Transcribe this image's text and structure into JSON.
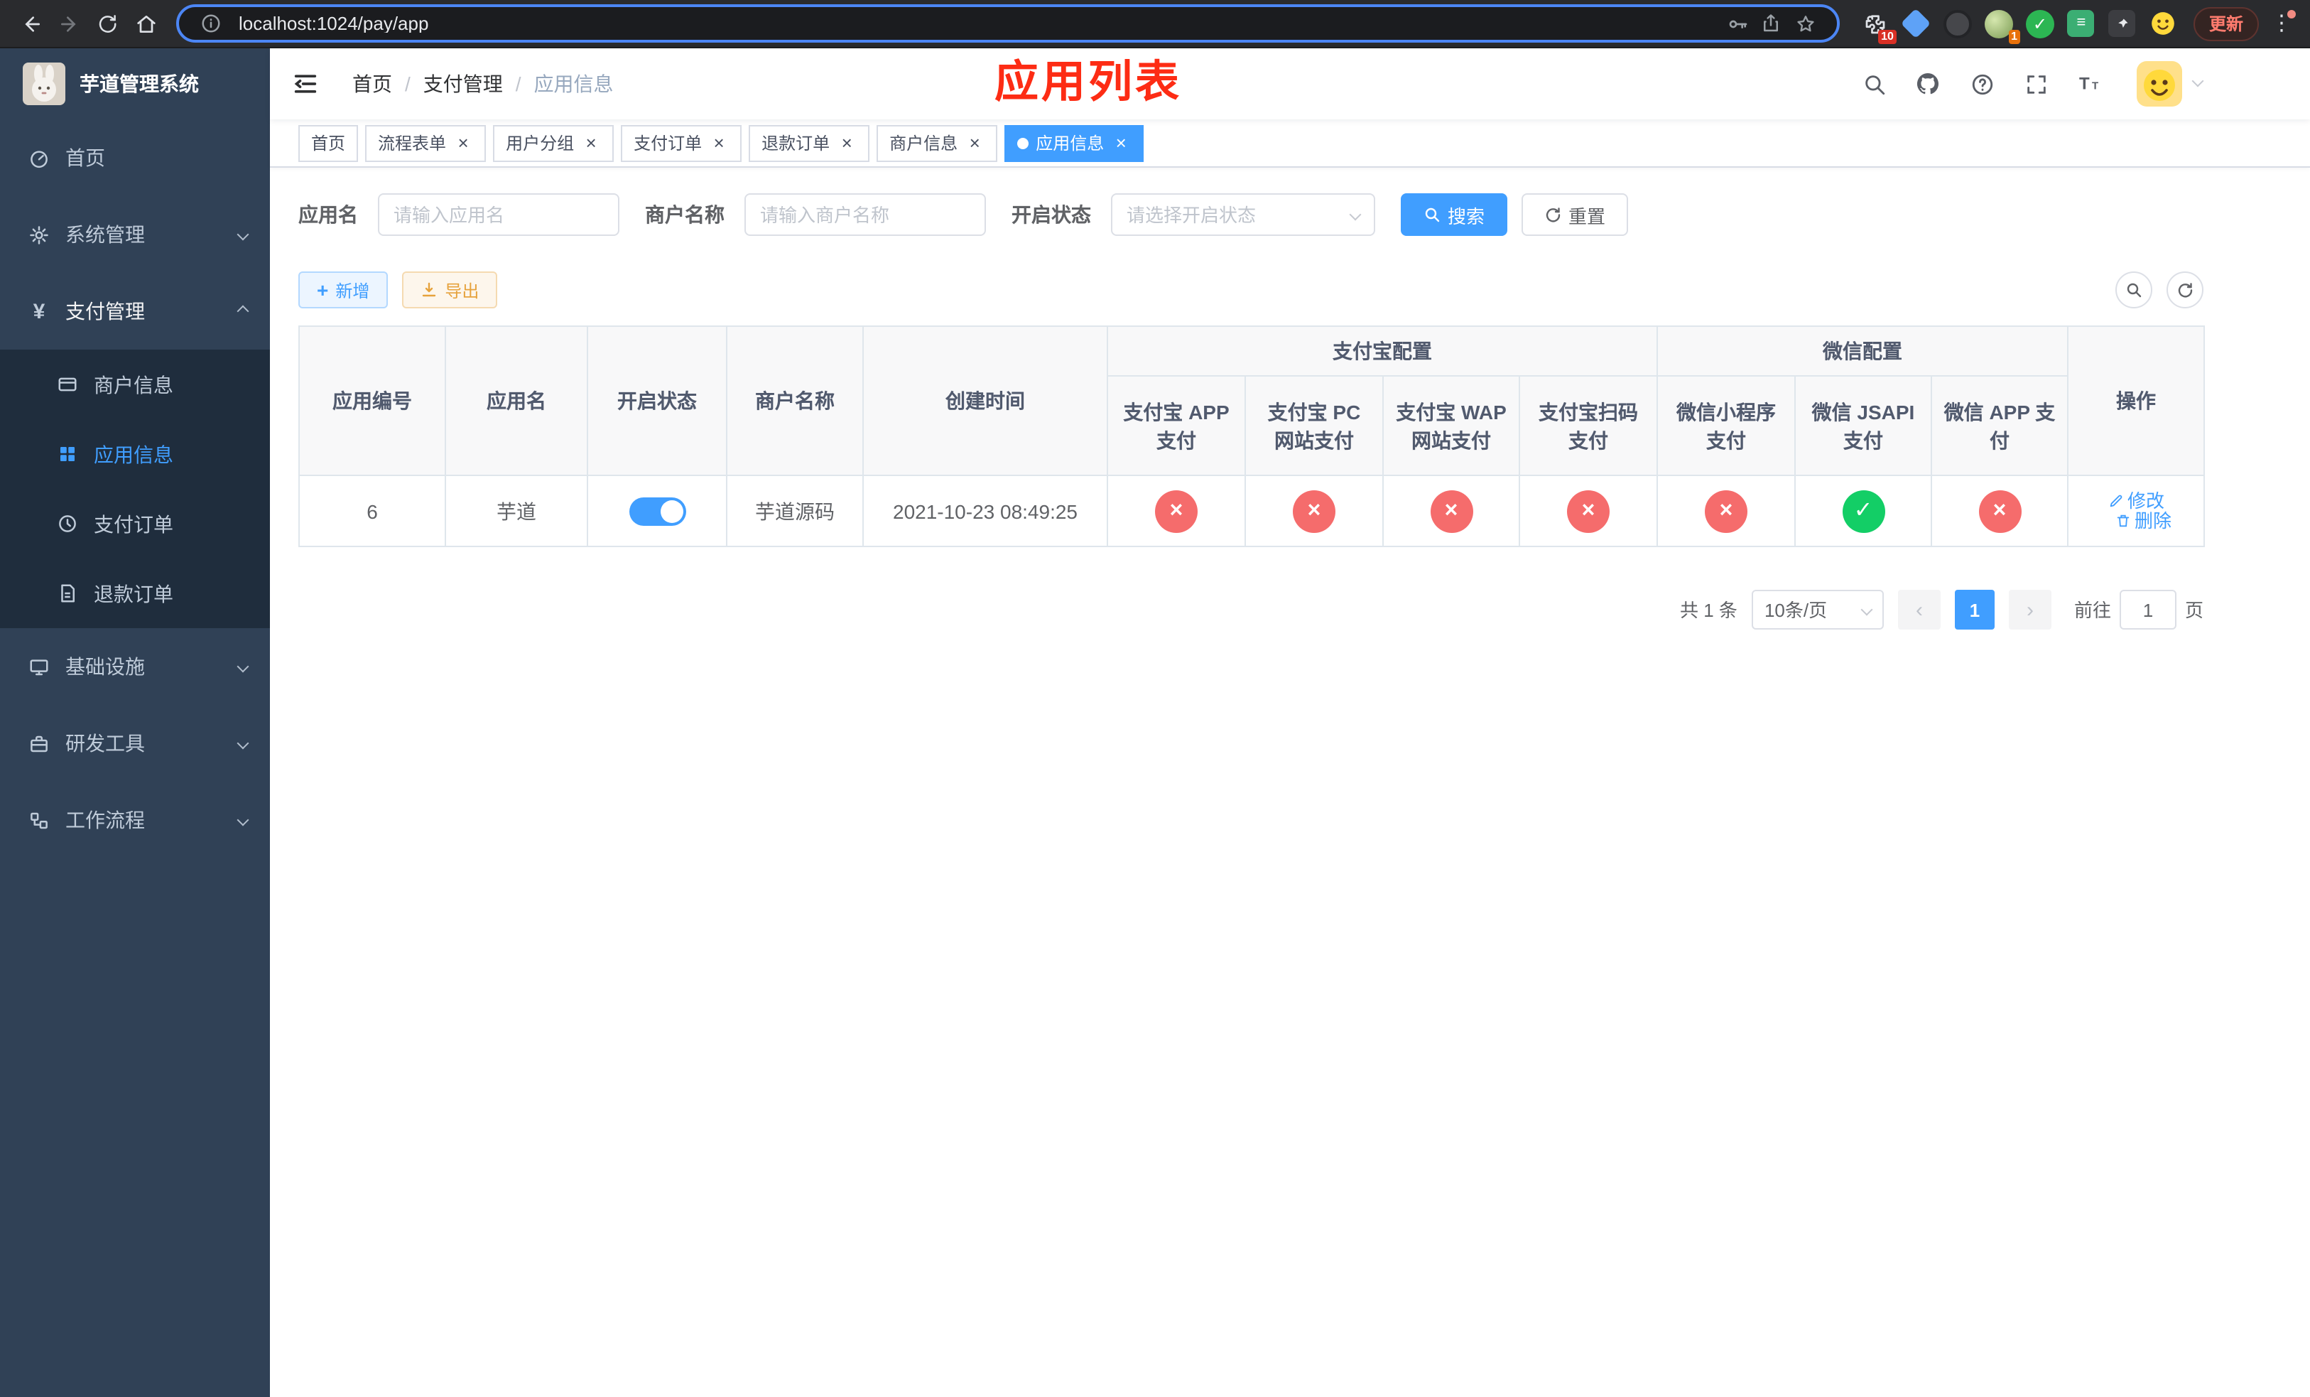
{
  "colors": {
    "primary": "#409eff",
    "success": "#13ce66",
    "danger": "#f56c6c",
    "warning": "#e6a23c",
    "annotation_red": "#fd2c14",
    "sidebar_bg": "#304156",
    "sidebar_submenu_bg": "#1f2d3d"
  },
  "icons": {
    "check": "✓",
    "cross": "×",
    "plus": "+",
    "prev": "‹",
    "next": "›",
    "dots": "⋮"
  },
  "browser": {
    "url": "localhost:1024/pay/app",
    "update_label": "更新",
    "extensions_badge": "10",
    "profile_badge": "1"
  },
  "sidebar": {
    "logo_title": "芋道管理系统",
    "menu": [
      {
        "label": "首页"
      },
      {
        "label": "系统管理"
      },
      {
        "label": "支付管理"
      },
      {
        "label": "商户信息"
      },
      {
        "label": "应用信息"
      },
      {
        "label": "支付订单"
      },
      {
        "label": "退款订单"
      },
      {
        "label": "基础设施"
      },
      {
        "label": "研发工具"
      },
      {
        "label": "工作流程"
      }
    ]
  },
  "navbar": {
    "breadcrumb": [
      "首页",
      "支付管理",
      "应用信息"
    ],
    "separator": "/",
    "annotation": "应用列表"
  },
  "tags": [
    {
      "label": "首页"
    },
    {
      "label": "流程表单"
    },
    {
      "label": "用户分组"
    },
    {
      "label": "支付订单"
    },
    {
      "label": "退款订单"
    },
    {
      "label": "商户信息"
    },
    {
      "label": "应用信息"
    }
  ],
  "filters": {
    "app_name_label": "应用名",
    "app_name_placeholder": "请输入应用名",
    "merchant_label": "商户名称",
    "merchant_placeholder": "请输入商户名称",
    "status_label": "开启状态",
    "status_placeholder": "请选择开启状态",
    "search_label": "搜索",
    "reset_label": "重置"
  },
  "toolbar": {
    "add_label": "新增",
    "export_label": "导出"
  },
  "table": {
    "headers": {
      "app_id": "应用编号",
      "app_name": "应用名",
      "status": "开启状态",
      "merchant": "商户名称",
      "create_time": "创建时间",
      "alipay_group": "支付宝配置",
      "wechat_group": "微信配置",
      "alipay_app": "支付宝 APP 支付",
      "alipay_pc": "支付宝 PC 网站支付",
      "alipay_wap": "支付宝 WAP 网站支付",
      "alipay_qr": "支付宝扫码支付",
      "wx_lite": "微信小程序支付",
      "wx_jsapi": "微信 JSAPI 支付",
      "wx_app": "微信 APP 支付",
      "actions": "操作"
    },
    "rows": [
      {
        "app_id": "6",
        "app_name": "芋道",
        "status_on": true,
        "merchant": "芋道源码",
        "create_time": "2021-10-23 08:49:25",
        "alipay_app": false,
        "alipay_pc": false,
        "alipay_wap": false,
        "alipay_qr": false,
        "wx_lite": false,
        "wx_jsapi": true,
        "wx_app": false,
        "edit_label": "修改",
        "delete_label": "删除"
      }
    ]
  },
  "pagination": {
    "total_label": "共 1 条",
    "page_size": "10条/页",
    "current_page": "1",
    "goto_label": "前往",
    "goto_value": "1",
    "page_label": "页"
  }
}
